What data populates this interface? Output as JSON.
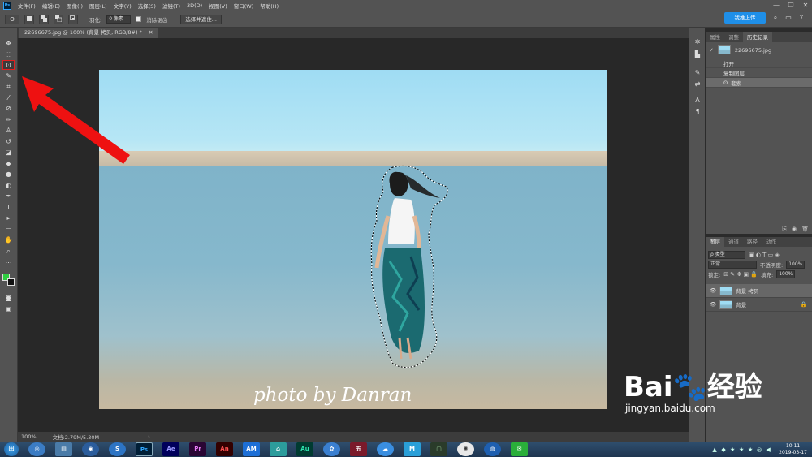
{
  "menubar": {
    "logo": "Ps",
    "items": [
      "文件(F)",
      "编辑(E)",
      "图像(I)",
      "图层(L)",
      "文字(Y)",
      "选择(S)",
      "滤镜(T)",
      "3D(D)",
      "视图(V)",
      "窗口(W)",
      "帮助(H)"
    ],
    "minimize": "—",
    "restore": "❐",
    "close": "✕"
  },
  "options": {
    "tool_icon": "ʘ",
    "feather_label": "羽化:",
    "feather_value": "0 像素",
    "antialias_label": "消除锯齿",
    "select_mask_label": "选择并遮住...",
    "cloud_button": "我推上传"
  },
  "document": {
    "tab_title": "22696675.jpg @ 100% (背景 拷贝, RGB/8#) *",
    "tab_close": "✕",
    "watermark": "photo by Danran",
    "zoom": "100%",
    "doc_info": "文档:2.79M/5.30M"
  },
  "history_panel": {
    "tabs": [
      "属性",
      "调整",
      "历史记录"
    ],
    "active_tab": "历史记录",
    "snapshot_name": "22696675.jpg",
    "steps": [
      "打开",
      "复制图层",
      "套索"
    ],
    "selected_step": "套索"
  },
  "layers_panel": {
    "tabs": [
      "图层",
      "通道",
      "路径",
      "动作"
    ],
    "active_tab": "图层",
    "filter_label": "ρ 类型",
    "blend_mode": "正常",
    "opacity_label": "不透明度:",
    "opacity_value": "100%",
    "lock_label": "锁定:",
    "fill_label": "填充:",
    "fill_value": "100%",
    "layers": [
      {
        "name": "背景 拷贝",
        "selected": true
      },
      {
        "name": "背景",
        "selected": false
      }
    ]
  },
  "taskbar": {
    "apps": [
      "Ps",
      "Ae",
      "Pr",
      "An",
      "AM",
      "Au",
      "五"
    ],
    "time": "10:11",
    "date": "2019-03-17"
  },
  "baidu_watermark": {
    "logo": "Bai🐾经验",
    "url": "jingyan.baidu.com"
  },
  "colors": {
    "ui_panel": "#535353",
    "canvas_bg": "#282828",
    "highlight_red": "#e02020",
    "cloud_blue": "#1f8fe8",
    "foreground_color": "#2ecc40",
    "background_color": "#111111"
  },
  "icons": {
    "lasso": "lasso-icon",
    "move": "move-icon",
    "arrow": "annotation-arrow-icon"
  }
}
